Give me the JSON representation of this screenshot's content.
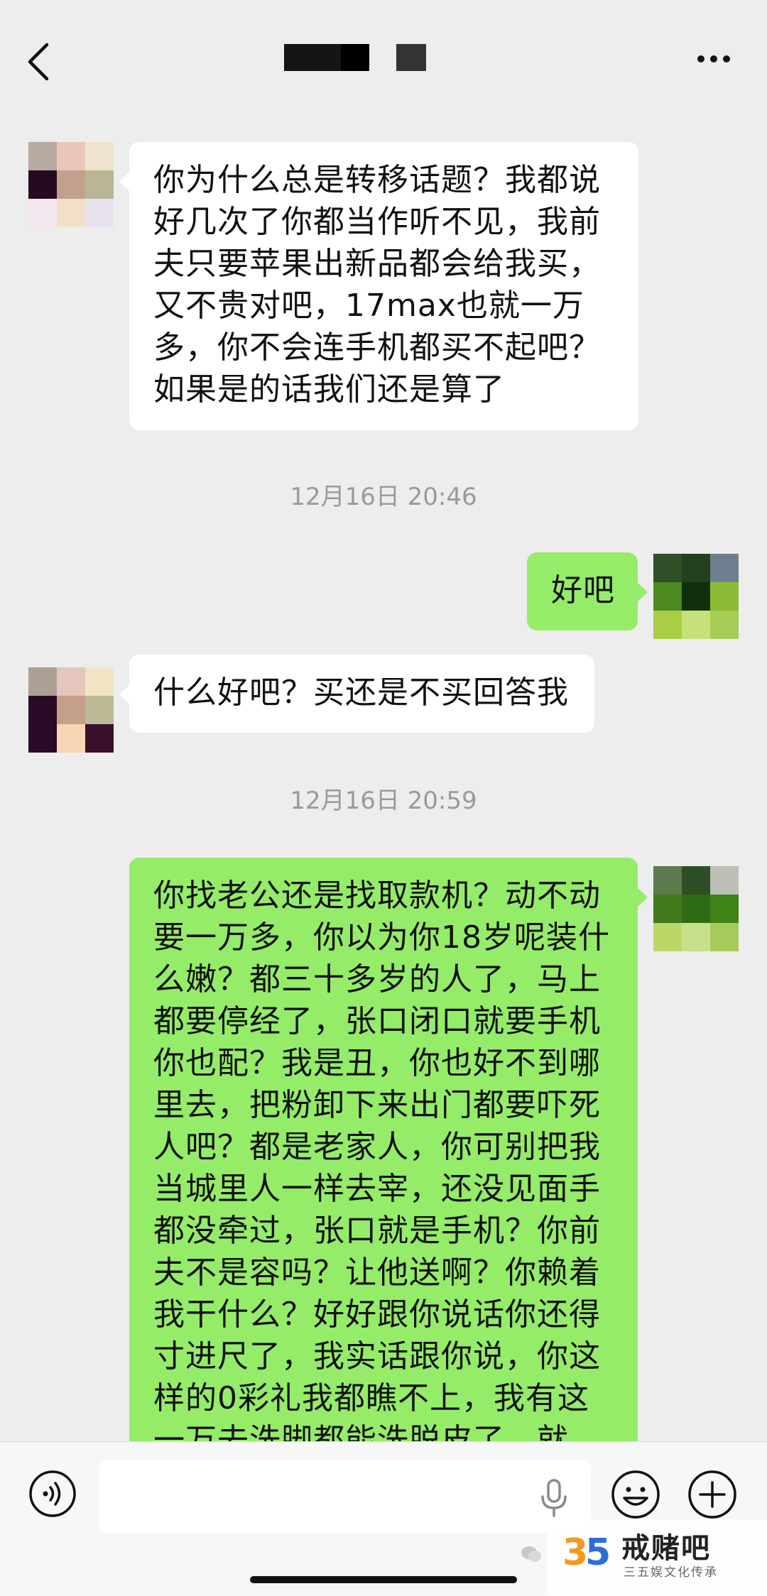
{
  "messages": [
    {
      "side": "left",
      "lines": [
        "你为什么总是转移话题？我都说",
        "好几次了你都当作听不见，我前",
        "夫只要苹果出新品都会给我买，",
        "又不贵对吧，17max也就一万",
        "多，你不会连手机都买不起吧？",
        "如果是的话我们还是算了"
      ]
    },
    {
      "timestamp": "12月16日 20:46"
    },
    {
      "side": "right",
      "lines": [
        "好吧"
      ]
    },
    {
      "side": "left",
      "lines": [
        "什么好吧？买还是不买回答我"
      ]
    },
    {
      "timestamp": "12月16日 20:59"
    },
    {
      "side": "right",
      "lines": [
        "你找老公还是找取款机？动不动",
        "要一万多，你以为你18岁呢装什",
        "么嫩？都三十多岁的人了，马上",
        "都要停经了，张口闭口就要手机",
        "你也配？我是丑，你也好不到哪",
        "里去，把粉卸下来出门都要吓死",
        "人吧？都是老家人，你可别把我",
        "当城里人一样去宰，还没见面手",
        "都没牵过，张口就是手机？你前",
        "夫不是容吗？让他送啊？你赖着",
        "我干什么？好好跟你说话你还得",
        "寸进尺了，我实话跟你说，你这",
        "样的0彩礼我都瞧不上，我有这",
        "一万去洗脚都能洗脱皮了，就"
      ]
    }
  ],
  "avatars": {
    "contact": [
      "#b7aaa0",
      "#e8c7ba",
      "#efe3cd",
      "#260a22",
      "#c2a08e",
      "#b9b695",
      "#f4e8f0",
      "#f2dfc8",
      "#e8e2ee"
    ],
    "contact2": [
      "#aaa094",
      "#e4c6bd",
      "#f0e4c5",
      "#2a0a26",
      "#c49f8a",
      "#bbb996",
      "#2a0a26",
      "#f5d7b5",
      "#3a0f2c"
    ],
    "me": [
      "#2f4f27",
      "#233f1e",
      "#6f7f91",
      "#4d8a22",
      "#112f0a",
      "#8cbc36",
      "#a9cd45",
      "#c7e17a",
      "#a6cc55"
    ],
    "me2": [
      "#5e7a4c",
      "#2e4f25",
      "#bcbfb4",
      "#3f7b1d",
      "#2f6b14",
      "#3e8218",
      "#bcd768",
      "#c8e08a",
      "#a7cb5a"
    ]
  },
  "watermark": {
    "title": "戒赌吧",
    "subtitle": "三五娱文化传承",
    "logo_text": "35"
  },
  "colors": {
    "bubble_right": "#95ec69",
    "bubble_left": "#ffffff",
    "background": "#ededed"
  }
}
